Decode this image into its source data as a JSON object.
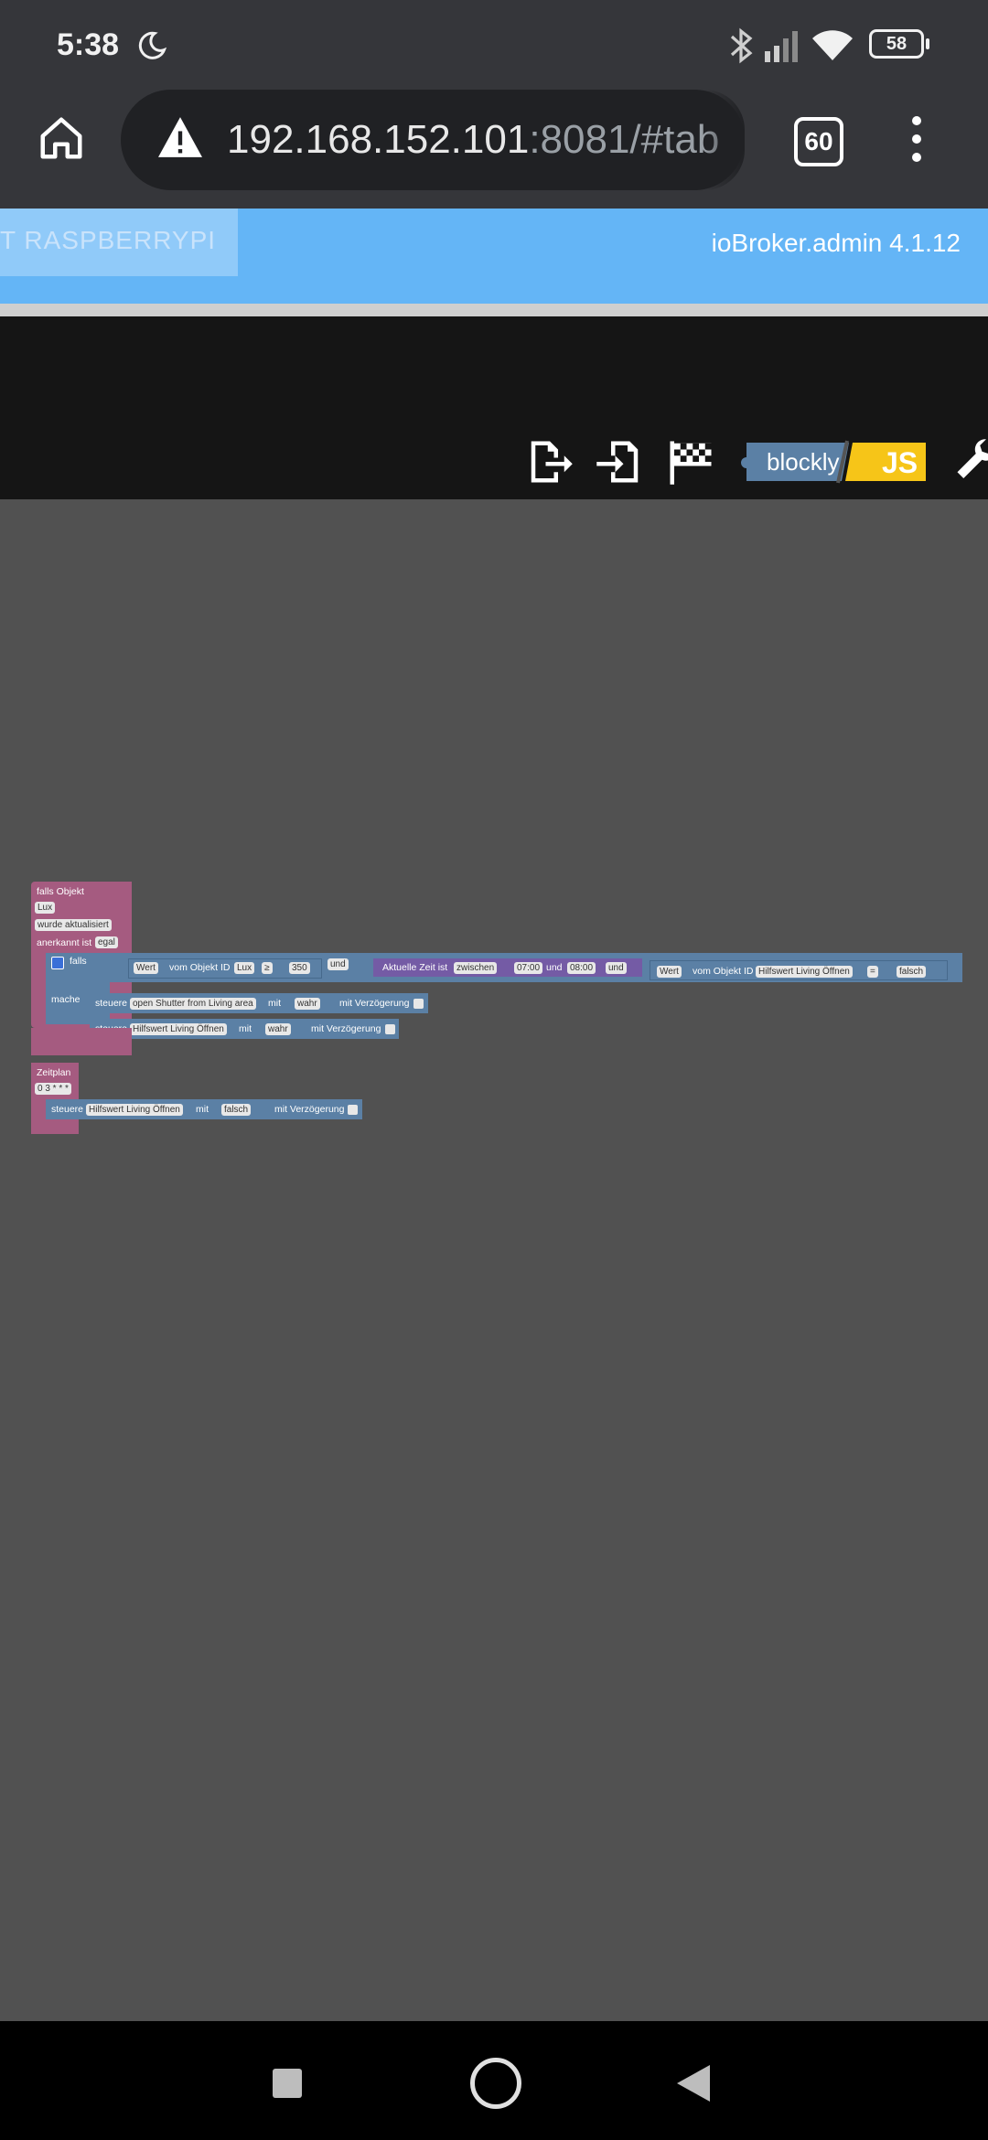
{
  "status_bar": {
    "time": "5:38",
    "battery": "58"
  },
  "browser": {
    "url_host": "192.168.152.101",
    "url_rest": ":8081/#tab",
    "tab_count": "60"
  },
  "app_header": {
    "tab_label": "T RASPBERRYPI",
    "admin_version": "ioBroker.admin 4.1.12"
  },
  "toolbar": {
    "icons": [
      "export-icon",
      "import-icon",
      "checkered-flag-icon",
      "blockly-js-toggle",
      "wrench-icon"
    ],
    "blockly_label": "blockly",
    "js_label": "JS"
  },
  "blocks": {
    "trigger": {
      "title": "falls Objekt",
      "object": "Lux",
      "event": "wurde aktualisiert",
      "ack_label": "anerkannt ist",
      "ack_value": "egal"
    },
    "if_block": {
      "falls": "falls",
      "mache": "mache",
      "cond1": {
        "wert": "Wert",
        "vom": "vom Objekt ID",
        "obj": "Lux",
        "op": "≥",
        "value": "350"
      },
      "und1": "und",
      "cond2": {
        "label": "Aktuelle Zeit ist",
        "mode": "zwischen",
        "from": "07:00",
        "und": "und",
        "to": "08:00"
      },
      "und2": "und",
      "cond3": {
        "wert": "Wert",
        "vom": "vom Objekt ID",
        "obj": "Hilfswert Living Öffnen",
        "op": "=",
        "value": "falsch"
      },
      "action1": {
        "steuere": "steuere",
        "target": "open Shutter from Living area",
        "mit": "mit",
        "value": "wahr",
        "delay": "mit Verzögerung"
      },
      "action2": {
        "steuere": "steuere",
        "target": "Hilfswert Living Öffnen",
        "mit": "mit",
        "value": "wahr",
        "delay": "mit Verzögerung"
      }
    },
    "schedule": {
      "title": "Zeitplan",
      "cron": "0 3 * * *",
      "action": {
        "steuere": "steuere",
        "target": "Hilfswert Living Öffnen",
        "mit": "mit",
        "value": "falsch",
        "delay": "mit Verzögerung"
      }
    }
  },
  "colors": {
    "appbar": "#64b5f6",
    "trigger_block": "#a55b80",
    "logic_block": "#5b80a5",
    "time_block": "#745ba5",
    "workspace": "#515151"
  }
}
